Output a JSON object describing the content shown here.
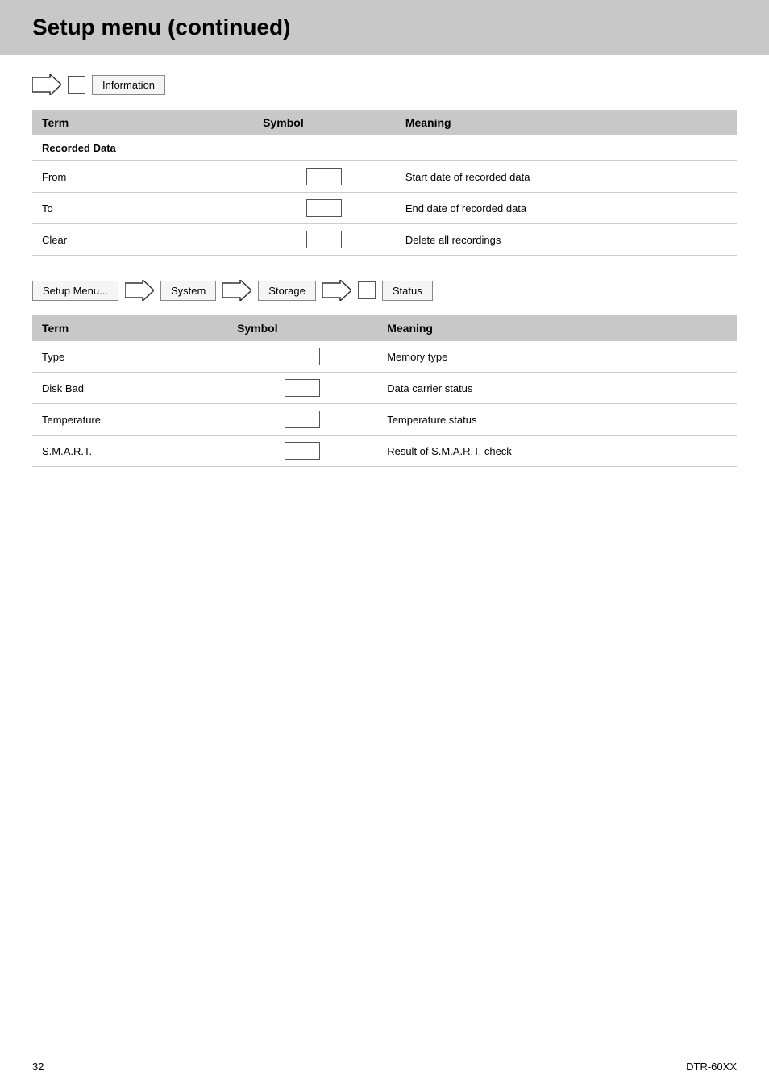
{
  "header": {
    "title": "Setup menu (continued)"
  },
  "section1": {
    "nav_label": "Information",
    "table": {
      "columns": [
        "Term",
        "Symbol",
        "Meaning"
      ],
      "rows": [
        {
          "term": "Recorded Data",
          "symbol": false,
          "meaning": "",
          "is_header": true
        },
        {
          "term": "From",
          "symbol": true,
          "meaning": "Start date of recorded data"
        },
        {
          "term": "To",
          "symbol": true,
          "meaning": "End date of recorded data"
        },
        {
          "term": "Clear",
          "symbol": true,
          "meaning": "Delete all recordings"
        }
      ]
    }
  },
  "section2": {
    "breadcrumb": {
      "items": [
        "Setup Menu...",
        "System",
        "Storage",
        "Status"
      ]
    },
    "table": {
      "columns": [
        "Term",
        "Symbol",
        "Meaning"
      ],
      "rows": [
        {
          "term": "Type",
          "symbol": true,
          "meaning": "Memory type"
        },
        {
          "term": "Disk Bad",
          "symbol": true,
          "meaning": "Data carrier status"
        },
        {
          "term": "Temperature",
          "symbol": true,
          "meaning": "Temperature status"
        },
        {
          "term": "S.M.A.R.T.",
          "symbol": true,
          "meaning": "Result of S.M.A.R.T. check"
        }
      ]
    }
  },
  "footer": {
    "page_number": "32",
    "document": "DTR-60XX"
  }
}
